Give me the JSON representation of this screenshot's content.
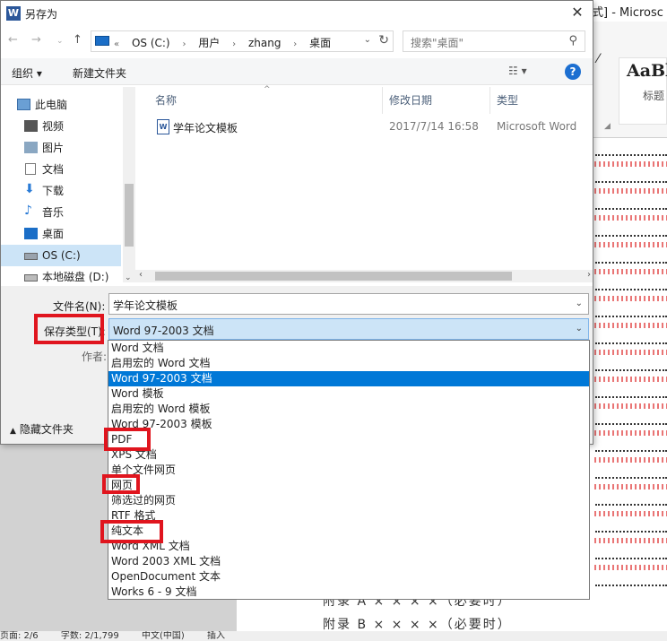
{
  "background": {
    "window_title_partial": "式] - Microsc",
    "style_preview": "AaBb",
    "style_label": "标题",
    "appendix_lines": [
      "附录 A    × × × ×（必要时）",
      "附录 B    × × × ×（必要时）"
    ],
    "status": [
      "页面: 2/6",
      "字数: 2/1,799",
      "中文(中国)",
      "插入"
    ]
  },
  "dialog": {
    "title": "另存为",
    "close": "✕",
    "breadcrumbs": [
      "OS (C:)",
      "用户",
      "zhang",
      "桌面"
    ],
    "search_placeholder": "搜索\"桌面\"",
    "toolbar": {
      "organize": "组织 ▾",
      "new_folder": "新建文件夹",
      "help": "?"
    },
    "nav": [
      "此电脑",
      "视频",
      "图片",
      "文档",
      "下载",
      "音乐",
      "桌面",
      "OS (C:)",
      "本地磁盘 (D:)"
    ],
    "columns": {
      "name": "名称",
      "modified": "修改日期",
      "type": "类型"
    },
    "files": [
      {
        "name": "学年论文模板",
        "modified": "2017/7/14 16:58",
        "type": "Microsoft Word"
      }
    ],
    "filename_label": "文件名(N):",
    "filename_value": "学年论文模板",
    "savetype_label": "保存类型(T):",
    "savetype_value": "Word 97-2003 文档",
    "author_label": "作者:",
    "hide_folders": "隐藏文件夹"
  },
  "options": [
    "Word 文档",
    "启用宏的 Word 文档",
    "Word 97-2003 文档",
    "Word 模板",
    "启用宏的 Word 模板",
    "Word 97-2003 模板",
    "PDF",
    "XPS 文档",
    "单个文件网页",
    "网页",
    "筛选过的网页",
    "RTF 格式",
    "纯文本",
    "Word XML 文档",
    "Word 2003 XML 文档",
    "OpenDocument 文本",
    "Works 6 - 9 文档"
  ],
  "selected_option_index": 2,
  "colors": {
    "highlight": "#0078d7",
    "annotation": "#e0151e",
    "selection": "#cce4f7"
  }
}
